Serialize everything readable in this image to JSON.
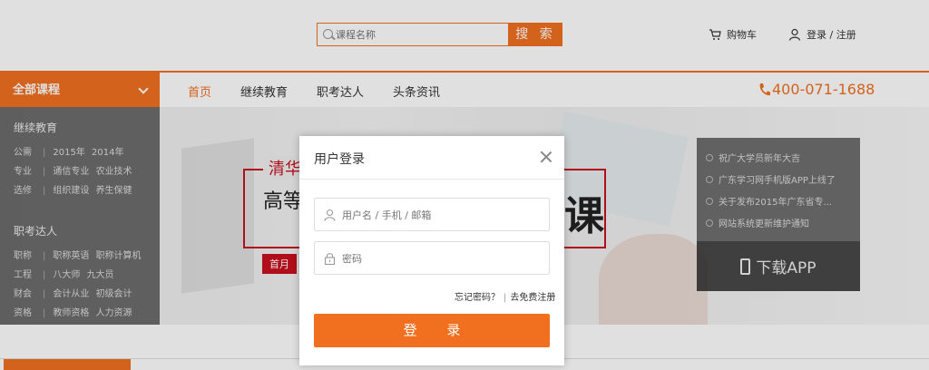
{
  "header": {
    "search_placeholder": "课程名称",
    "search_button": "搜 索",
    "cart_label": "购物车",
    "login_register": "登录 / 注册"
  },
  "nav": {
    "all_courses": "全部课程",
    "links": [
      "首页",
      "继续教育",
      "职考达人",
      "头条资讯"
    ],
    "active_index": 0,
    "phone": "400-071-1688"
  },
  "categories": {
    "group1_title": "继续教育",
    "group1_rows": [
      [
        "公需",
        "2015年",
        "2014年"
      ],
      [
        "专业",
        "通信专业",
        "农业技术"
      ],
      [
        "选修",
        "组织建设",
        "养生保健"
      ]
    ],
    "group2_title": "职考达人",
    "group2_rows": [
      [
        "职称",
        "职称英语",
        "职称计算机"
      ],
      [
        "工程",
        "八大师",
        "九大员"
      ],
      [
        "财会",
        "会计从业",
        "初级会计"
      ],
      [
        "资格",
        "教师资格",
        "人力资源"
      ]
    ]
  },
  "banner": {
    "title1": "清华",
    "title2": "高等",
    "big_char": "课",
    "tag": "首月"
  },
  "news": {
    "items": [
      "祝广大学员新年大吉",
      "广东学习网手机版APP上线了",
      "关于发布2015年广东省专...",
      "网站系统更新维护通知"
    ],
    "app_label": "下载APP"
  },
  "modal": {
    "title": "用户登录",
    "username_placeholder": "用户名 / 手机 / 邮箱",
    "password_placeholder": "密码",
    "forgot_password": "忘记密码？",
    "free_register": "去免费注册",
    "login_button": "登 录"
  },
  "colors": {
    "accent": "#f07020",
    "banner_red": "#c8101e"
  }
}
